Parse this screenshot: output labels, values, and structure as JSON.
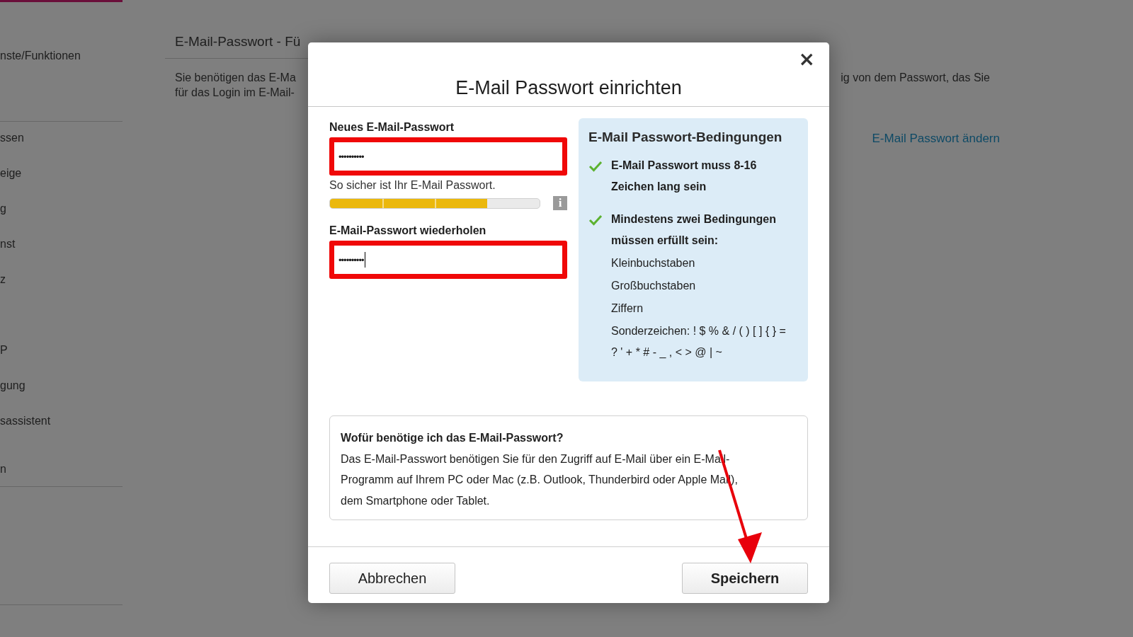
{
  "sidebar": {
    "groups": [
      [
        "nste/Funktionen"
      ],
      [
        "ssen",
        "eige",
        "g",
        "nst",
        "z"
      ],
      [
        "P",
        "gung",
        "sassistent"
      ],
      [
        "n"
      ]
    ]
  },
  "page": {
    "heading": "E-Mail-Passwort - Fü",
    "text_left": [
      "Sie benötigen das E-Ma",
      "für das Login im E-Mail-"
    ],
    "text_right": "ig von dem Passwort, das Sie",
    "link": "E-Mail Passwort ändern"
  },
  "dialog": {
    "title": "E-Mail Passwort einrichten",
    "close": "×",
    "new_password": {
      "label": "Neues E-Mail-Passwort",
      "value": "••••••••••",
      "highlighted": true
    },
    "strength": {
      "label": "So sicher ist Ihr E-Mail Passwort.",
      "level": 0.75,
      "info": "i"
    },
    "repeat_password": {
      "label": "E-Mail-Passwort wiederholen",
      "value": "••••••••••",
      "highlighted": true,
      "focused": true
    },
    "conditions": {
      "title": "E-Mail Passwort-Bedingungen",
      "items": [
        {
          "kind": "check",
          "text": "E-Mail Passwort muss 8-16 Zeichen lang sein"
        },
        {
          "kind": "check",
          "text": "Mindestens zwei Bedingungen müssen erfüllt sein:"
        },
        {
          "kind": "plain",
          "text": "Kleinbuchstaben"
        },
        {
          "kind": "plain",
          "text": "Großbuchstaben"
        },
        {
          "kind": "plain",
          "text": "Ziffern"
        },
        {
          "kind": "plain",
          "text": "Sonderzeichen: ! $ % & / ( ) [ ] { } = ? ' + * # - _ , < > @ | ~"
        }
      ]
    },
    "help": {
      "question": "Wofür benötige ich das E-Mail-Passwort?",
      "answer": "Das E-Mail-Passwort benötigen Sie für den Zugriff auf E-Mail über ein E-Mail-Programm auf Ihrem PC oder Mac (z.B. Outlook, Thunderbird oder Apple Mail), dem Smartphone oder Tablet."
    },
    "buttons": [
      {
        "label": "Abbrechen",
        "primary": false
      },
      {
        "label": "Speichern",
        "primary": true
      }
    ]
  }
}
